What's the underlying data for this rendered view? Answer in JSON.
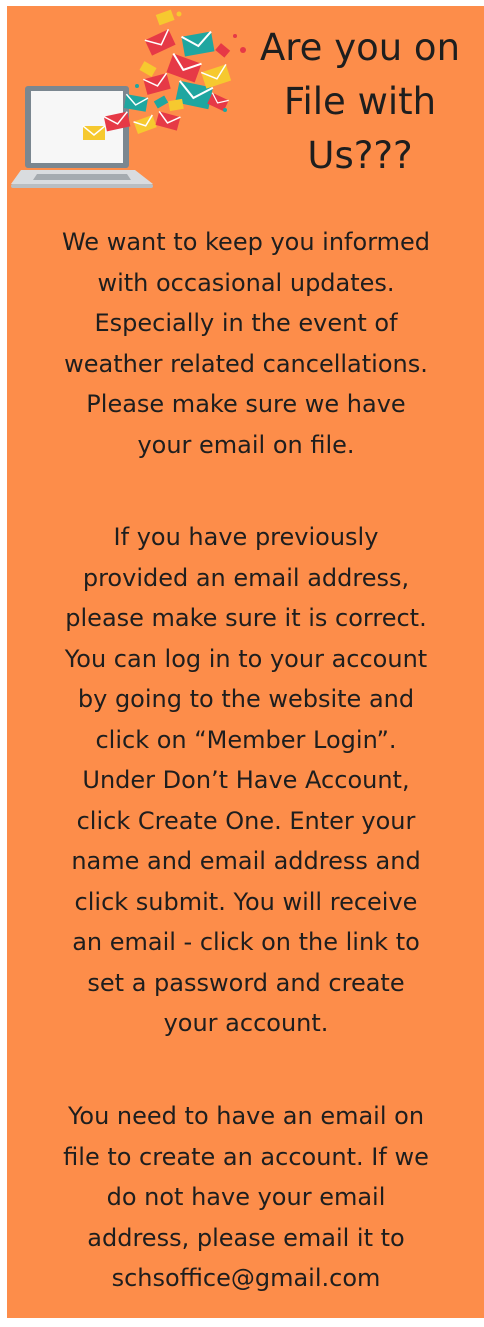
{
  "colors": {
    "background": "#fd8d4a",
    "text": "#1e1e1e"
  },
  "illustration": {
    "icon": "laptop-with-flying-envelopes-icon"
  },
  "title_lines": [
    "Are you on",
    "File with",
    "Us???"
  ],
  "paragraph1_lines": [
    "We want to keep you informed",
    "with occasional updates.",
    "Especially in the event of",
    "weather related cancellations.",
    "Please make sure we have",
    "your email on file."
  ],
  "paragraph2_lines": [
    "If you have previously",
    "provided an email address,",
    "please make sure it is correct.",
    "You can log in to your account",
    "by going to the website and",
    "click on “Member Login”.",
    "Under Don’t Have Account,",
    "click Create One.  Enter your",
    "name and email address and",
    "click submit.  You will receive",
    "an email - click on the link to",
    "set a password and create",
    "your account."
  ],
  "paragraph3_lines": [
    "You need to have an email on",
    "file to create an account.  If we",
    "do not have your email",
    "address, please email it to",
    "schsoffice@gmail.com"
  ]
}
